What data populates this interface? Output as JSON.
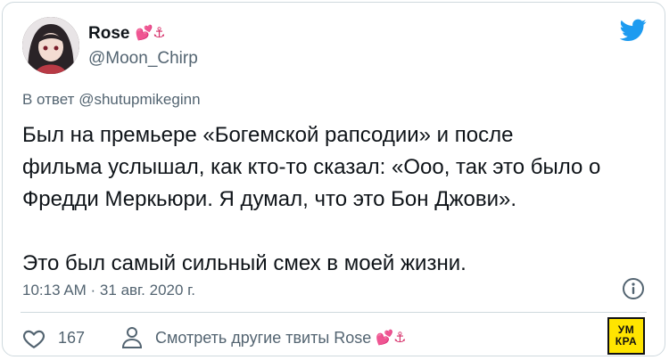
{
  "tweet": {
    "display_name": "Rose",
    "name_emoji": "💕⚓",
    "handle": "@Moon_Chirp",
    "reply_prefix": "В ответ",
    "reply_mention": "@shutupmikeginn",
    "text": "Был на премьере «Богемской рапсодии» и после\nфильма услышал, как кто-то сказал: «Ооо, так это было о\nФредди Меркьюри. Я думал, что это Бон Джови».\n\nЭто был самый сильный смех в моей жизни.",
    "timestamp": "10:13 AM · 31 авг. 2020 г.",
    "like_count": "167",
    "more_tweets_label": "Смотреть другие твиты Rose",
    "more_tweets_emoji": "💕⚓"
  },
  "watermark": {
    "line1": "УМ",
    "line2": "КРА"
  },
  "icons": {
    "brand": "twitter-bird-icon",
    "info": "info-icon",
    "like": "heart-icon",
    "profile": "person-icon"
  },
  "colors": {
    "twitter_blue": "#1d9bf0",
    "muted": "#536471",
    "watermark_yellow": "#ffe500"
  }
}
